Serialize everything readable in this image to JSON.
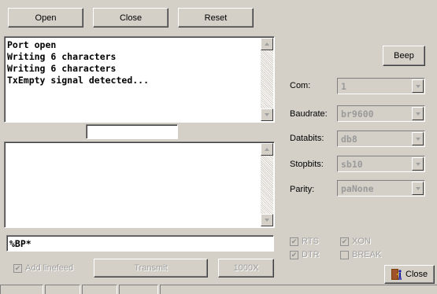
{
  "toolbar": {
    "open_label": "Open",
    "close_label": "Close",
    "reset_label": "Reset"
  },
  "output_memo": {
    "lines": "Port open\nWriting 6 characters\nWriting 6 characters\nTxEmpty signal detected..."
  },
  "small_field": {
    "value": ""
  },
  "input_memo": {
    "value": ""
  },
  "send_field": {
    "value": "%BP*"
  },
  "add_linefeed": {
    "label": "Add linefeed",
    "checked": true
  },
  "transmit_label": "Transmit",
  "repeat_label": "1000X",
  "beep_label": "Beep",
  "settings": {
    "com": {
      "label": "Com:",
      "value": "1"
    },
    "baudrate": {
      "label": "Baudrate:",
      "value": "br9600"
    },
    "databits": {
      "label": "Databits:",
      "value": "db8"
    },
    "stopbits": {
      "label": "Stopbits:",
      "value": "sb10"
    },
    "parity": {
      "label": "Parity:",
      "value": "paNone"
    }
  },
  "signals": {
    "rts": {
      "label": "RTS",
      "checked": true
    },
    "xon": {
      "label": "XON",
      "checked": true
    },
    "dtr": {
      "label": "DTR",
      "checked": true
    },
    "break": {
      "label": "BREAK",
      "checked": false
    }
  },
  "close_button_label": "Close",
  "icons": {
    "close_button_icon": "door-exit-icon"
  }
}
